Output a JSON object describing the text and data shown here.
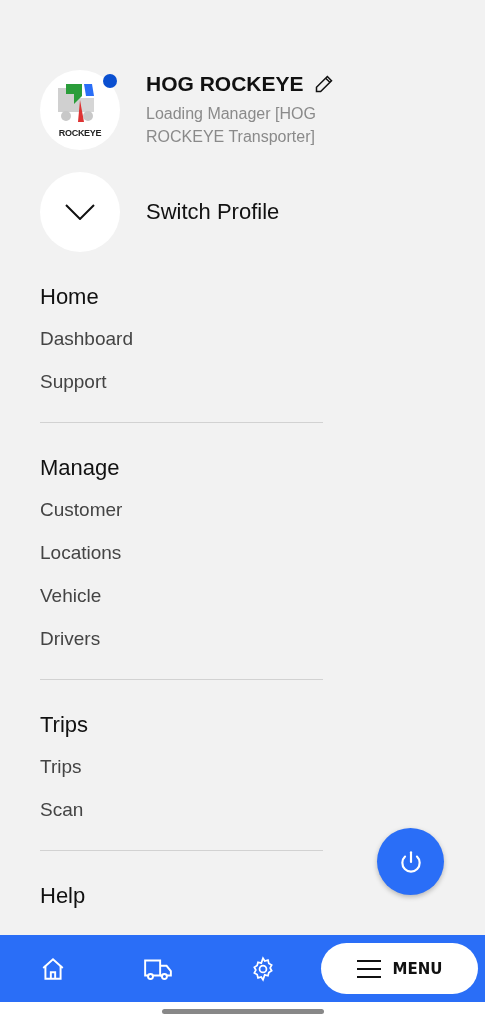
{
  "profile": {
    "logo_text": "ROCKEYE",
    "online": true,
    "name": "HOG ROCKEYE",
    "role": "Loading Manager [HOG ROCKEYE Transporter]"
  },
  "switch_profile": {
    "label": "Switch Profile",
    "expanded": false
  },
  "sections": [
    {
      "title": "Home",
      "items": [
        "Dashboard",
        "Support"
      ]
    },
    {
      "title": "Manage",
      "items": [
        "Customer",
        "Locations",
        "Vehicle",
        "Drivers"
      ]
    },
    {
      "title": "Trips",
      "items": [
        "Trips",
        "Scan"
      ]
    },
    {
      "title": "Help"
    }
  ],
  "bottom_nav": {
    "menu_label": "MENU"
  }
}
